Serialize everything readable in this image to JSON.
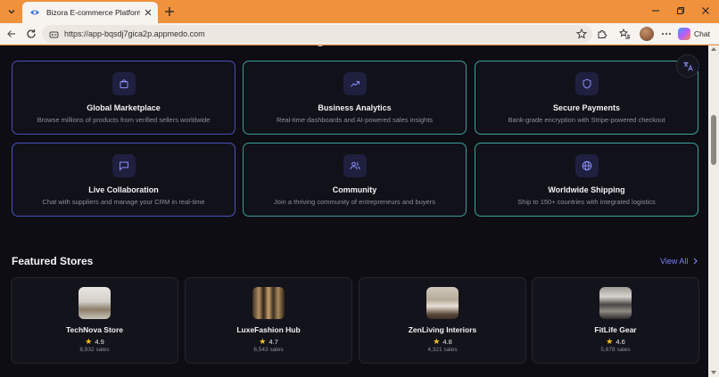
{
  "browser": {
    "tab_title": "Bizora E-commerce Platform",
    "url": "https://app-bqsdj7gica2p.appmedo.com",
    "chat_label": "Chat"
  },
  "features": [
    {
      "icon": "shopping-bag-icon",
      "title": "Global Marketplace",
      "description": "Browse millions of products from verified sellers worldwide"
    },
    {
      "icon": "trending-up-icon",
      "title": "Business Analytics",
      "description": "Real-time dashboards and AI-powered sales insights"
    },
    {
      "icon": "shield-icon",
      "title": "Secure Payments",
      "description": "Bank-grade encryption with Stripe-powered checkout"
    },
    {
      "icon": "message-square-icon",
      "title": "Live Collaboration",
      "description": "Chat with suppliers and manage your CRM in real-time"
    },
    {
      "icon": "users-icon",
      "title": "Community",
      "description": "Join a thriving community of entrepreneurs and buyers"
    },
    {
      "icon": "globe-icon",
      "title": "Worldwide Shipping",
      "description": "Ship to 150+ countries with integrated logistics"
    }
  ],
  "featured": {
    "title": "Featured Stores",
    "view_all": "View All",
    "stores": [
      {
        "name": "TechNova Store",
        "rating": "4.9",
        "sales": "8,932 sales"
      },
      {
        "name": "LuxeFashion Hub",
        "rating": "4.7",
        "sales": "6,543 sales"
      },
      {
        "name": "ZenLiving Interiors",
        "rating": "4.8",
        "sales": "4,321 sales"
      },
      {
        "name": "FitLife Gear",
        "rating": "4.6",
        "sales": "5,678 sales"
      }
    ]
  },
  "colors": {
    "accent": "#7b7ff5",
    "page_bg": "#0d0d13",
    "browser_frame": "#f0913c",
    "star": "#f5c518"
  }
}
